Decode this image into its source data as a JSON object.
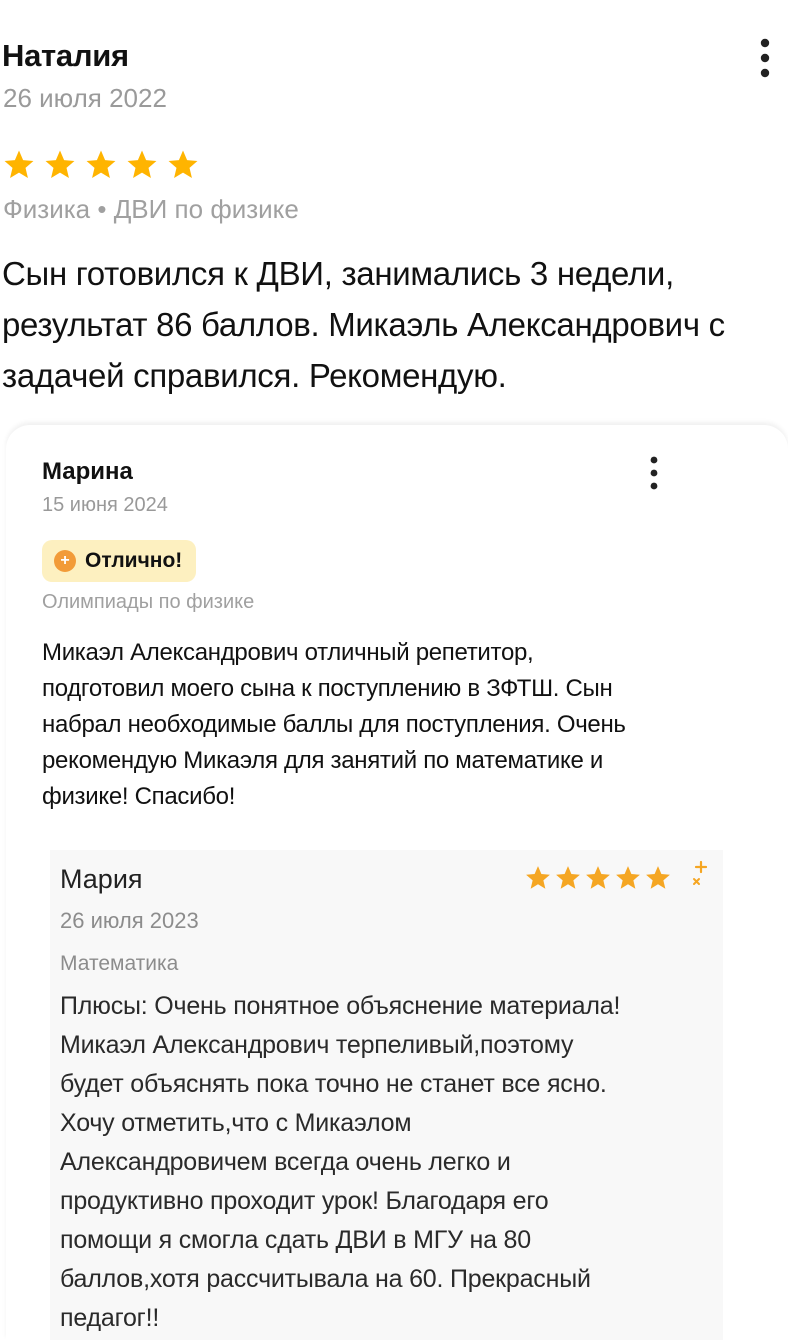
{
  "colors": {
    "star": "#ffb400",
    "star_screenshot": "#f5a623",
    "badge_bg": "#fdf0c0",
    "badge_icon": "#f29b38",
    "muted_text": "#9a9a9a"
  },
  "review1": {
    "author": "Наталия",
    "date": "26 июля 2022",
    "rating": 5,
    "tags": "Физика • ДВИ по физике",
    "text": "Сын готовился к ДВИ, занимались 3 недели, результат 86 баллов. Микаэль Александрович с задачей справился. Рекомендую.",
    "menu_icon": "more-vertical-icon"
  },
  "review2": {
    "author": "Марина",
    "date": "15 июня 2024",
    "badge": {
      "icon": "plus-circle-icon",
      "label": "Отлично!"
    },
    "tags": "Олимпиады по физике",
    "text": "Микаэл Александрович отличный репетитор, подготовил моего сына к поступлению в ЗФТШ. Сын набрал необходимые баллы для поступления. Очень рекомендую Микаэля для занятий по математике и физике! Спасибо!",
    "menu_icon": "more-vertical-icon"
  },
  "review3": {
    "author": "Мария",
    "date": "26 июля 2023",
    "rating": 5,
    "tags": "Математика",
    "text_lines": [
      "Плюсы: Очень понятное объяснение материала!",
      "Микаэл Александрович терпеливый,поэтому",
      "будет объяснять пока точно не станет все ясно.",
      "Хочу отметить,что с Микаэлом",
      "Александровичем всегда очень легко и",
      "продуктивно проходит урок! Благодаря его",
      "помощи я смогла сдать ДВИ в МГУ на 80",
      "баллов,хотя рассчитывала на 60. Прекрасный",
      "педагог!!"
    ]
  }
}
